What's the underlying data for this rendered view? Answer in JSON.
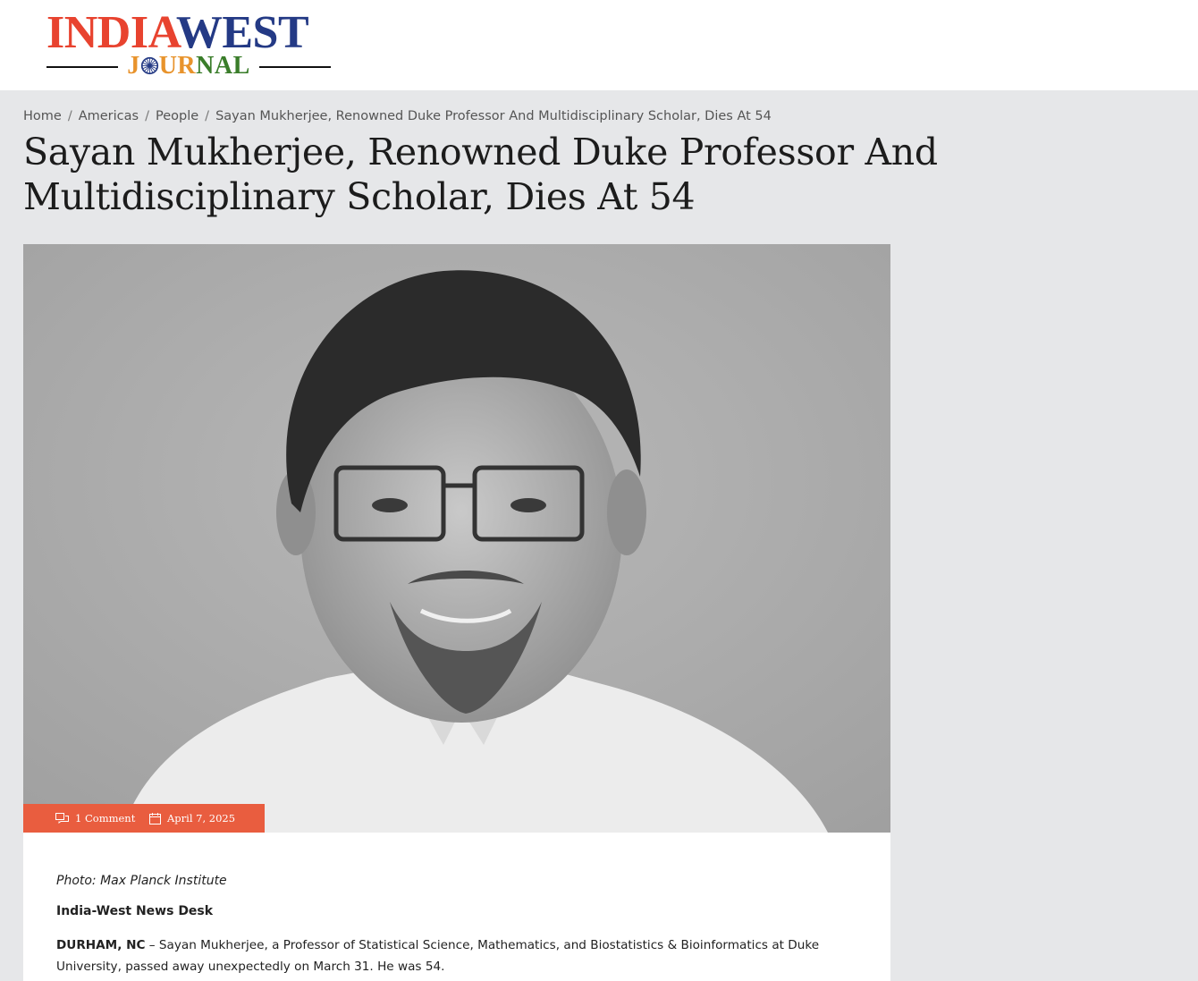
{
  "header": {
    "logo": {
      "word1": "INDIA",
      "word2": "WEST",
      "sub_before": "J",
      "sub_after_orange": "UR",
      "sub_after_green": "NAL"
    }
  },
  "breadcrumb": {
    "items": [
      "Home",
      "Americas",
      "People"
    ],
    "current": "Sayan Mukherjee, Renowned Duke Professor And Multidisciplinary Scholar, Dies At 54",
    "separator": "/"
  },
  "article": {
    "title": "Sayan Mukherjee, Renowned Duke Professor And Multidisciplinary Scholar, Dies At 54",
    "meta": {
      "comments": "1 Comment",
      "date": "April 7, 2025"
    },
    "caption": "Photo: Max Planck Institute",
    "byline": "India-West News Desk",
    "dateline": "DURHAM, NC",
    "lead_text": " – Sayan Mukherjee, a Professor of Statistical Science, Mathematics, and Biostatistics & Bioinformatics at Duke University, passed away unexpectedly on March 31. He was 54."
  },
  "colors": {
    "brand_red": "#e8432f",
    "brand_blue": "#243a85",
    "brand_orange": "#e8932c",
    "brand_green": "#3a7d2a",
    "meta_bar": "#e95d3f",
    "page_bg": "#e6e7e9"
  },
  "icons": [
    "ashoka-chakra-icon",
    "comments-icon",
    "calendar-icon"
  ]
}
